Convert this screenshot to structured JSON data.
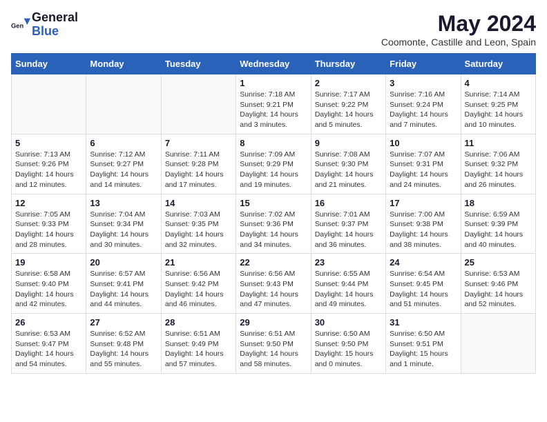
{
  "header": {
    "logo_general": "General",
    "logo_blue": "Blue",
    "month_title": "May 2024",
    "location": "Coomonte, Castille and Leon, Spain"
  },
  "weekdays": [
    "Sunday",
    "Monday",
    "Tuesday",
    "Wednesday",
    "Thursday",
    "Friday",
    "Saturday"
  ],
  "weeks": [
    [
      {
        "day": "",
        "info": ""
      },
      {
        "day": "",
        "info": ""
      },
      {
        "day": "",
        "info": ""
      },
      {
        "day": "1",
        "info": "Sunrise: 7:18 AM\nSunset: 9:21 PM\nDaylight: 14 hours and 3 minutes."
      },
      {
        "day": "2",
        "info": "Sunrise: 7:17 AM\nSunset: 9:22 PM\nDaylight: 14 hours and 5 minutes."
      },
      {
        "day": "3",
        "info": "Sunrise: 7:16 AM\nSunset: 9:24 PM\nDaylight: 14 hours and 7 minutes."
      },
      {
        "day": "4",
        "info": "Sunrise: 7:14 AM\nSunset: 9:25 PM\nDaylight: 14 hours and 10 minutes."
      }
    ],
    [
      {
        "day": "5",
        "info": "Sunrise: 7:13 AM\nSunset: 9:26 PM\nDaylight: 14 hours and 12 minutes."
      },
      {
        "day": "6",
        "info": "Sunrise: 7:12 AM\nSunset: 9:27 PM\nDaylight: 14 hours and 14 minutes."
      },
      {
        "day": "7",
        "info": "Sunrise: 7:11 AM\nSunset: 9:28 PM\nDaylight: 14 hours and 17 minutes."
      },
      {
        "day": "8",
        "info": "Sunrise: 7:09 AM\nSunset: 9:29 PM\nDaylight: 14 hours and 19 minutes."
      },
      {
        "day": "9",
        "info": "Sunrise: 7:08 AM\nSunset: 9:30 PM\nDaylight: 14 hours and 21 minutes."
      },
      {
        "day": "10",
        "info": "Sunrise: 7:07 AM\nSunset: 9:31 PM\nDaylight: 14 hours and 24 minutes."
      },
      {
        "day": "11",
        "info": "Sunrise: 7:06 AM\nSunset: 9:32 PM\nDaylight: 14 hours and 26 minutes."
      }
    ],
    [
      {
        "day": "12",
        "info": "Sunrise: 7:05 AM\nSunset: 9:33 PM\nDaylight: 14 hours and 28 minutes."
      },
      {
        "day": "13",
        "info": "Sunrise: 7:04 AM\nSunset: 9:34 PM\nDaylight: 14 hours and 30 minutes."
      },
      {
        "day": "14",
        "info": "Sunrise: 7:03 AM\nSunset: 9:35 PM\nDaylight: 14 hours and 32 minutes."
      },
      {
        "day": "15",
        "info": "Sunrise: 7:02 AM\nSunset: 9:36 PM\nDaylight: 14 hours and 34 minutes."
      },
      {
        "day": "16",
        "info": "Sunrise: 7:01 AM\nSunset: 9:37 PM\nDaylight: 14 hours and 36 minutes."
      },
      {
        "day": "17",
        "info": "Sunrise: 7:00 AM\nSunset: 9:38 PM\nDaylight: 14 hours and 38 minutes."
      },
      {
        "day": "18",
        "info": "Sunrise: 6:59 AM\nSunset: 9:39 PM\nDaylight: 14 hours and 40 minutes."
      }
    ],
    [
      {
        "day": "19",
        "info": "Sunrise: 6:58 AM\nSunset: 9:40 PM\nDaylight: 14 hours and 42 minutes."
      },
      {
        "day": "20",
        "info": "Sunrise: 6:57 AM\nSunset: 9:41 PM\nDaylight: 14 hours and 44 minutes."
      },
      {
        "day": "21",
        "info": "Sunrise: 6:56 AM\nSunset: 9:42 PM\nDaylight: 14 hours and 46 minutes."
      },
      {
        "day": "22",
        "info": "Sunrise: 6:56 AM\nSunset: 9:43 PM\nDaylight: 14 hours and 47 minutes."
      },
      {
        "day": "23",
        "info": "Sunrise: 6:55 AM\nSunset: 9:44 PM\nDaylight: 14 hours and 49 minutes."
      },
      {
        "day": "24",
        "info": "Sunrise: 6:54 AM\nSunset: 9:45 PM\nDaylight: 14 hours and 51 minutes."
      },
      {
        "day": "25",
        "info": "Sunrise: 6:53 AM\nSunset: 9:46 PM\nDaylight: 14 hours and 52 minutes."
      }
    ],
    [
      {
        "day": "26",
        "info": "Sunrise: 6:53 AM\nSunset: 9:47 PM\nDaylight: 14 hours and 54 minutes."
      },
      {
        "day": "27",
        "info": "Sunrise: 6:52 AM\nSunset: 9:48 PM\nDaylight: 14 hours and 55 minutes."
      },
      {
        "day": "28",
        "info": "Sunrise: 6:51 AM\nSunset: 9:49 PM\nDaylight: 14 hours and 57 minutes."
      },
      {
        "day": "29",
        "info": "Sunrise: 6:51 AM\nSunset: 9:50 PM\nDaylight: 14 hours and 58 minutes."
      },
      {
        "day": "30",
        "info": "Sunrise: 6:50 AM\nSunset: 9:50 PM\nDaylight: 15 hours and 0 minutes."
      },
      {
        "day": "31",
        "info": "Sunrise: 6:50 AM\nSunset: 9:51 PM\nDaylight: 15 hours and 1 minute."
      },
      {
        "day": "",
        "info": ""
      }
    ]
  ]
}
